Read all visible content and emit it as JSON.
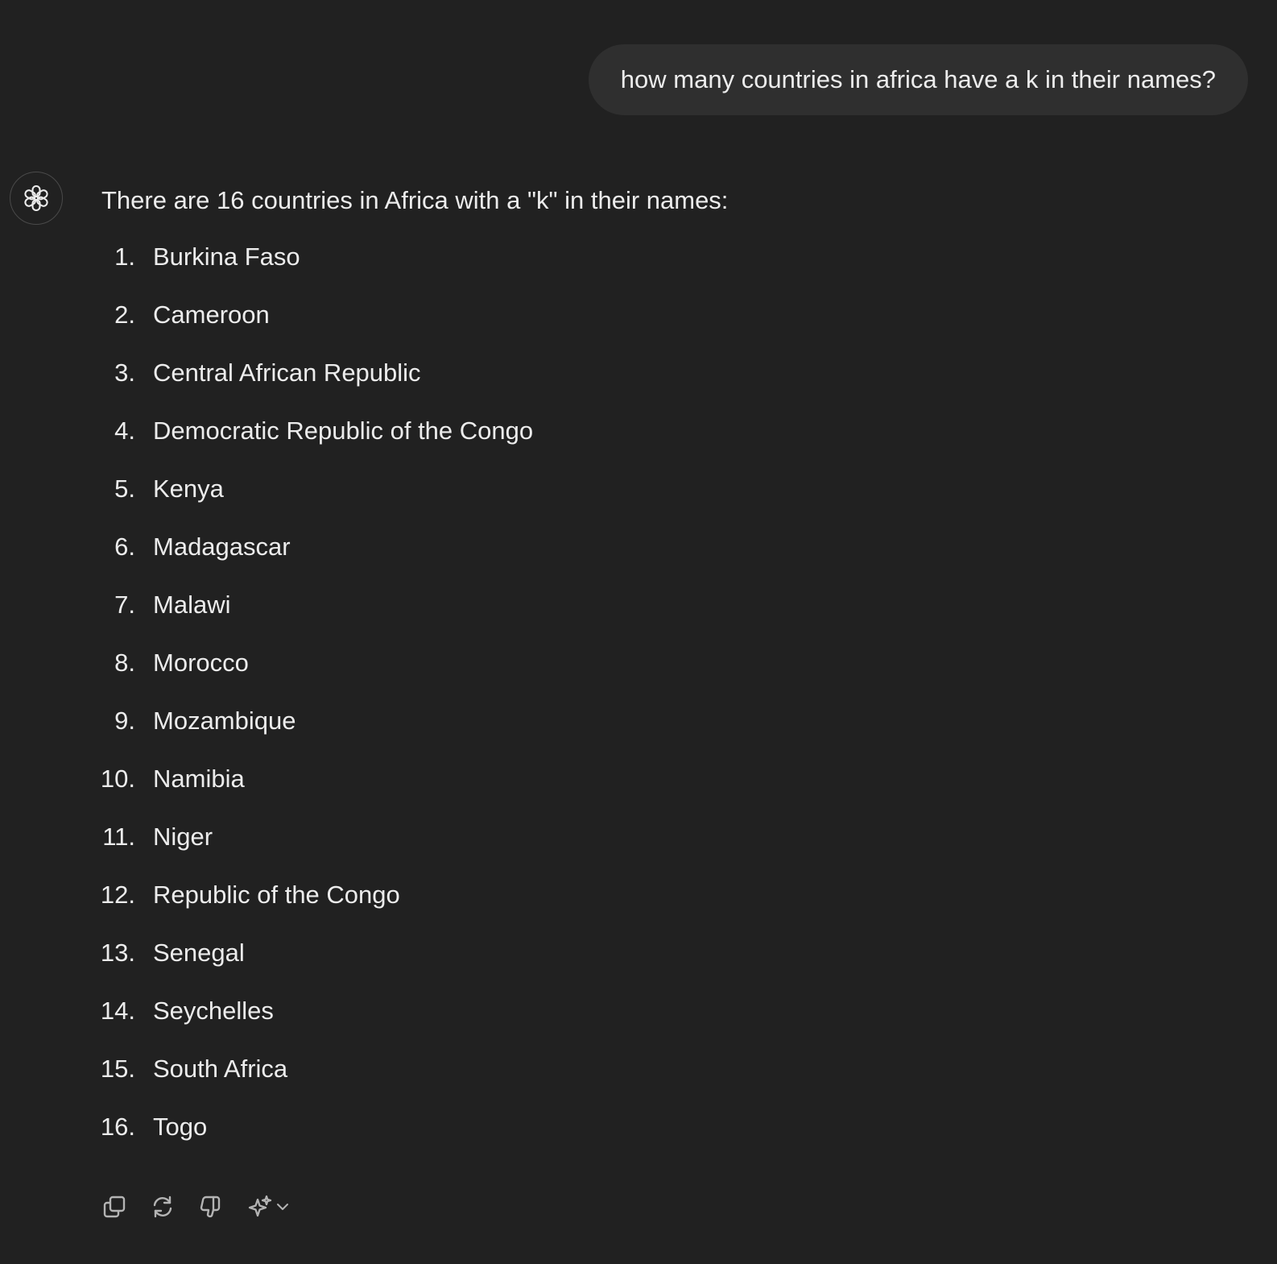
{
  "user_message": {
    "text": "how many countries in africa have a k in their names?"
  },
  "assistant": {
    "avatar_icon": "openai-logo-icon",
    "intro": "There are 16 countries in Africa with a \"k\" in their names:",
    "list": [
      {
        "num": "1.",
        "text": "Burkina Faso"
      },
      {
        "num": "2.",
        "text": "Cameroon"
      },
      {
        "num": "3.",
        "text": "Central African Republic"
      },
      {
        "num": "4.",
        "text": "Democratic Republic of the Congo"
      },
      {
        "num": "5.",
        "text": "Kenya"
      },
      {
        "num": "6.",
        "text": "Madagascar"
      },
      {
        "num": "7.",
        "text": "Malawi"
      },
      {
        "num": "8.",
        "text": "Morocco"
      },
      {
        "num": "9.",
        "text": "Mozambique"
      },
      {
        "num": "10.",
        "text": "Namibia"
      },
      {
        "num": "11.",
        "text": "Niger"
      },
      {
        "num": "12.",
        "text": "Republic of the Congo"
      },
      {
        "num": "13.",
        "text": "Senegal"
      },
      {
        "num": "14.",
        "text": "Seychelles"
      },
      {
        "num": "15.",
        "text": "South Africa"
      },
      {
        "num": "16.",
        "text": "Togo"
      }
    ]
  },
  "toolbar": {
    "icons": [
      "copy-icon",
      "regenerate-icon",
      "thumbs-down-icon",
      "sparkle-icon",
      "chevron-down-icon"
    ]
  },
  "colors": {
    "background": "#212121",
    "bubble": "#2f2f2f",
    "text": "#ececec",
    "icon": "#b4b4b4"
  }
}
